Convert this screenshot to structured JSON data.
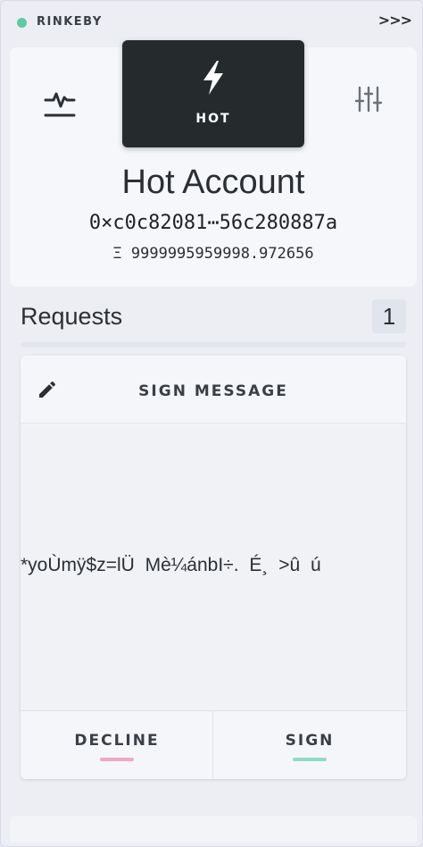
{
  "network": {
    "label": "RINKEBY",
    "status_color": "#5ccaa4"
  },
  "header": {
    "expand_icon": "chevron-triple-right-icon",
    "expand_label": ">>>"
  },
  "account": {
    "signer_type": "HOT",
    "name": "Hot Account",
    "address": "0×c0c82081⋯56c280887a",
    "balance": "Ξ 9999995959998.972656",
    "activity_icon": "activity-pulse-icon",
    "settings_icon": "sliders-icon",
    "signer_icon": "lightning-bolt-icon"
  },
  "requests": {
    "title": "Requests",
    "count": "1",
    "items": [
      {
        "type": "SIGN MESSAGE",
        "icon": "pencil-icon",
        "message": "*yoÙmÿ$z=lÜ  Mè¼ánbI÷. É¸ >û  ú",
        "decline_label": "DECLINE",
        "sign_label": "SIGN",
        "decline_color": "#f0a8c4",
        "sign_color": "#8fdcc6"
      }
    ]
  }
}
